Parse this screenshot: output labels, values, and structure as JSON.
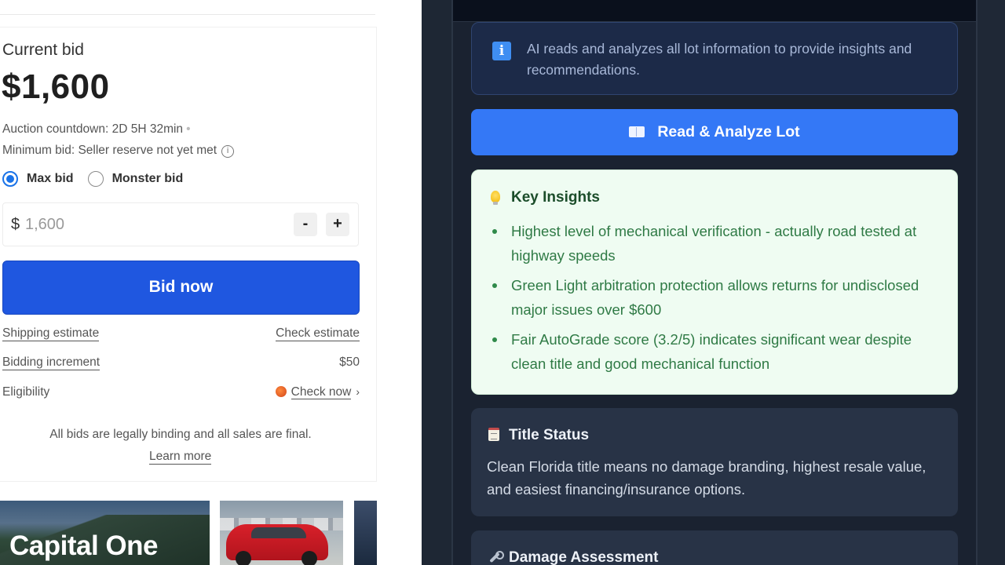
{
  "bid_panel": {
    "current_bid_label": "Current bid",
    "current_bid_amount": "$1,600",
    "countdown": "Auction countdown: 2D 5H 32min",
    "minimum_bid": "Minimum bid: Seller reserve not yet met",
    "bid_types": [
      {
        "label": "Max bid",
        "selected": true
      },
      {
        "label": "Monster bid",
        "selected": false
      }
    ],
    "input_currency": "$",
    "input_value": "1,600",
    "minus_label": "-",
    "plus_label": "+",
    "bid_button": "Bid now",
    "shipping_label": "Shipping estimate",
    "shipping_link": "Check estimate",
    "increment_label": "Bidding increment",
    "increment_value": "$50",
    "eligibility_label": "Eligibility",
    "eligibility_link": "Check now",
    "legal_text": "All bids are legally binding and all sales are final.",
    "learn_more": "Learn more"
  },
  "thumbnails": {
    "brand_text": "Capital One"
  },
  "ai_panel": {
    "info_text": "AI reads and analyzes all lot information to provide insights and recommendations.",
    "analyze_button": "Read & Analyze Lot",
    "key_insights": {
      "title": "Key Insights",
      "items": [
        "Highest level of mechanical verification - actually road tested at highway speeds",
        "Green Light arbitration protection allows returns for undisclosed major issues over $600",
        "Fair AutoGrade score (3.2/5) indicates significant wear despite clean title and good mechanical function"
      ]
    },
    "title_status": {
      "title": "Title Status",
      "text": "Clean Florida title means no damage branding, highest resale value, and easiest financing/insurance options."
    },
    "damage_assessment": {
      "title": "Damage Assessment"
    }
  },
  "icons": {
    "info": "info-icon",
    "book": "book-icon",
    "bulb": "lightbulb-icon",
    "memo": "memo-icon",
    "wrench": "wrench-icon"
  },
  "colors": {
    "bid_button": "#1f57e0",
    "analyze_button": "#3478f6",
    "insights_bg": "#effcf2",
    "insights_text": "#2f7a45",
    "panel_bg": "#1a2230"
  }
}
